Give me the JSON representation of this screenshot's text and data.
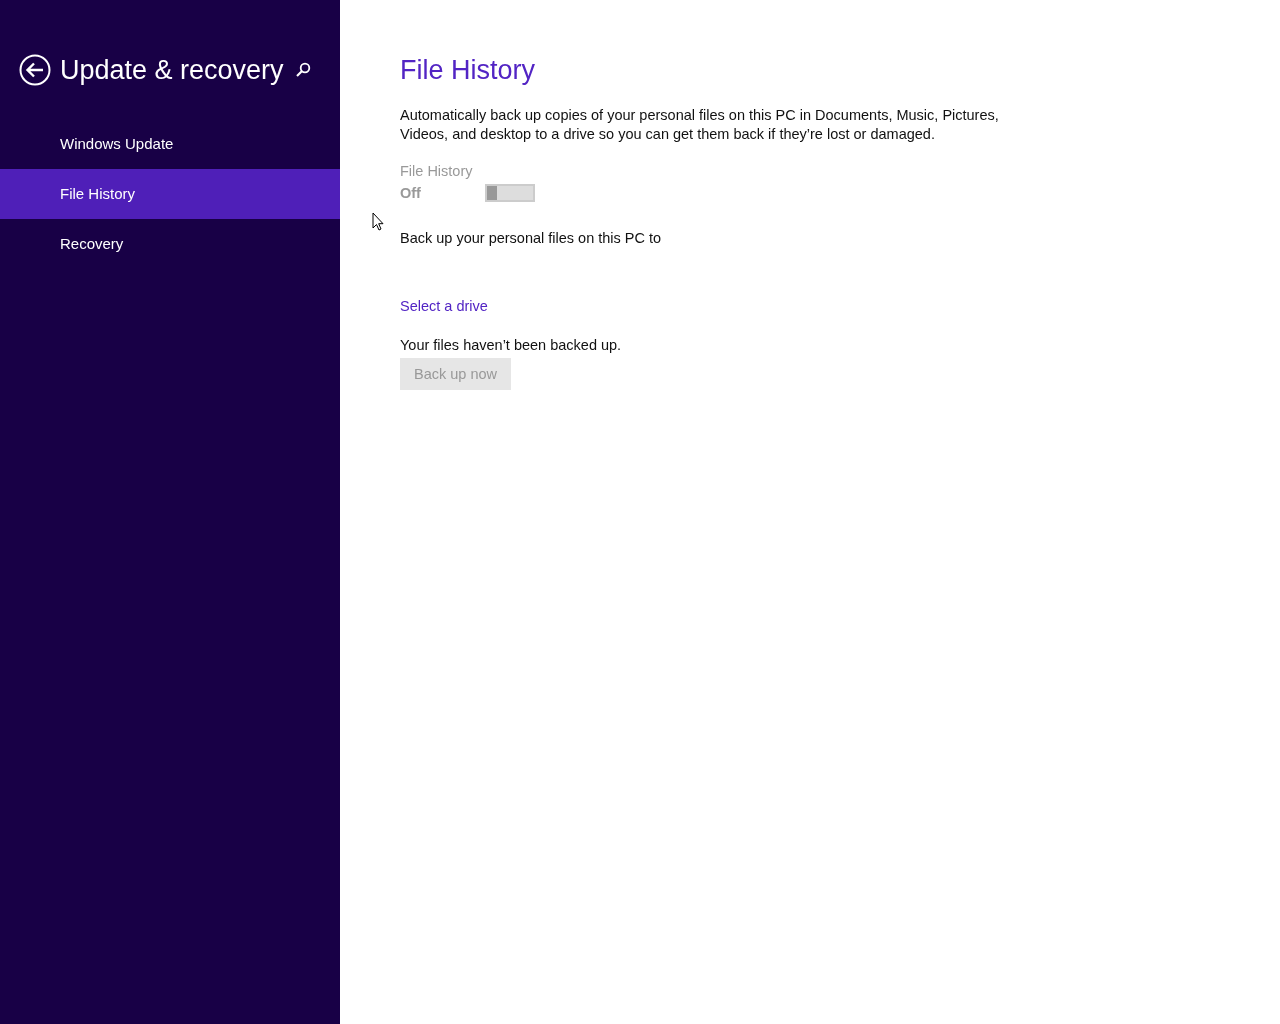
{
  "sidebar": {
    "title": "Update & recovery",
    "items": [
      {
        "label": "Windows Update",
        "selected": false
      },
      {
        "label": "File History",
        "selected": true
      },
      {
        "label": "Recovery",
        "selected": false
      }
    ]
  },
  "content": {
    "title": "File History",
    "description": "Automatically back up copies of your personal files on this PC in Documents, Music, Pictures, Videos, and desktop to a drive so you can get them back if they’re lost or damaged.",
    "toggle": {
      "label": "File History",
      "state_text": "Off",
      "on": false,
      "disabled": true
    },
    "backup_target_text": "Back up your personal files on this PC to",
    "select_drive_link": "Select a drive",
    "status_text": "Your files haven’t been backed up.",
    "backup_button": {
      "label": "Back up now",
      "disabled": true
    }
  }
}
